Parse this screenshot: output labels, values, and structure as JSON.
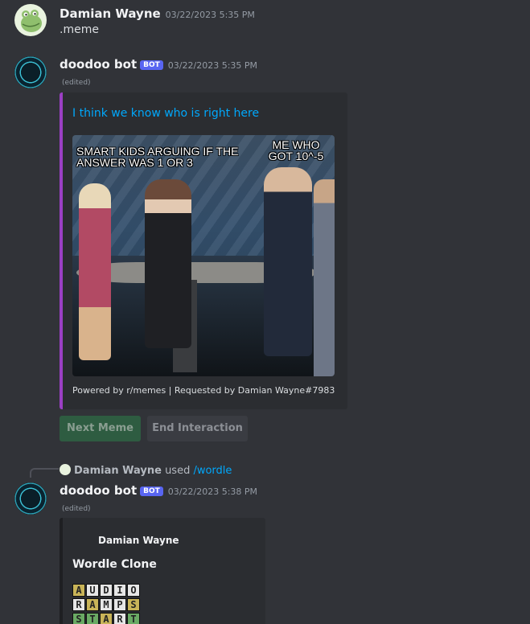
{
  "messages": [
    {
      "username": "Damian Wayne",
      "timestamp": "03/22/2023 5:35 PM",
      "content": ".meme"
    },
    {
      "username": "doodoo bot",
      "bot_tag": "BOT",
      "timestamp": "03/22/2023 5:35 PM",
      "edited": "(edited)",
      "embed": {
        "title": "I think we know who is right here",
        "image": {
          "caption_left": "SMART KIDS ARGUING IF THE ANSWER WAS 1 OR 3",
          "caption_right": "ME WHO GOT 10^-5"
        },
        "footer": "Powered by r/memes | Requested by Damian Wayne#7983",
        "accent_color": "#9b3fc4"
      },
      "buttons": [
        {
          "label": "Next Meme",
          "style": "success"
        },
        {
          "label": "End Interaction",
          "style": "secondary"
        }
      ]
    },
    {
      "reply": {
        "username": "Damian Wayne",
        "used": "used",
        "command": "/wordle"
      },
      "username": "doodoo bot",
      "bot_tag": "BOT",
      "timestamp": "03/22/2023 5:38 PM",
      "edited": "(edited)",
      "embed": {
        "author": "Damian Wayne",
        "title": "Wordle Clone",
        "grid": [
          [
            {
              "l": "A",
              "c": "y"
            },
            {
              "l": "U",
              "c": "w"
            },
            {
              "l": "D",
              "c": "w"
            },
            {
              "l": "I",
              "c": "w"
            },
            {
              "l": "O",
              "c": "w"
            }
          ],
          [
            {
              "l": "R",
              "c": "w"
            },
            {
              "l": "A",
              "c": "y"
            },
            {
              "l": "M",
              "c": "w"
            },
            {
              "l": "P",
              "c": "w"
            },
            {
              "l": "S",
              "c": "y"
            }
          ],
          [
            {
              "l": "S",
              "c": "g"
            },
            {
              "l": "T",
              "c": "g"
            },
            {
              "l": "A",
              "c": "y"
            },
            {
              "l": "R",
              "c": "w"
            },
            {
              "l": "T",
              "c": "g"
            }
          ]
        ],
        "accent_color": "#1e1f22"
      }
    }
  ]
}
